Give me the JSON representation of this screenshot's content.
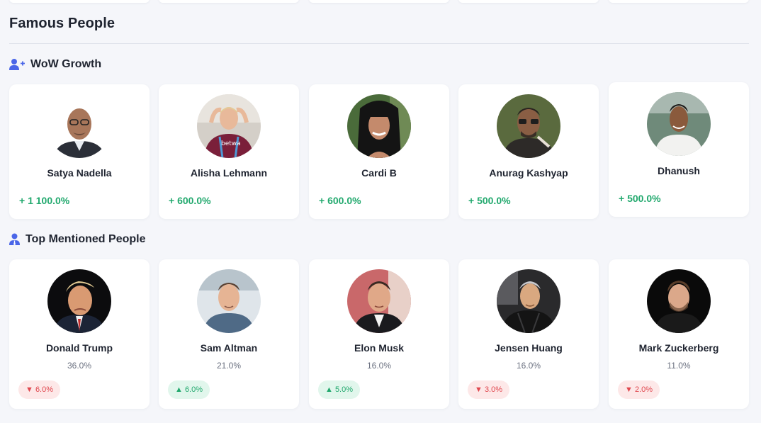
{
  "page": {
    "title": "Famous People"
  },
  "colors": {
    "accent": "#4a66e8",
    "growth": "#22a96e",
    "down_bg": "#fde8e8",
    "down_text": "#e0484f",
    "up_bg": "#e1f6ec",
    "up_text": "#22a96e"
  },
  "wow_growth": {
    "title": "WoW Growth",
    "icon": "user-plus-icon",
    "people": [
      {
        "name": "Satya Nadella",
        "growth": "+ 1 100.0%"
      },
      {
        "name": "Alisha Lehmann",
        "growth": "+ 600.0%"
      },
      {
        "name": "Cardi B",
        "growth": "+ 600.0%"
      },
      {
        "name": "Anurag Kashyap",
        "growth": "+ 500.0%"
      },
      {
        "name": "Dhanush",
        "growth": "+ 500.0%"
      }
    ]
  },
  "top_mentioned": {
    "title": "Top Mentioned People",
    "icon": "user-tie-icon",
    "people": [
      {
        "name": "Donald Trump",
        "share": "36.0%",
        "change": "▼ 6.0%",
        "direction": "down"
      },
      {
        "name": "Sam Altman",
        "share": "21.0%",
        "change": "▲ 6.0%",
        "direction": "up"
      },
      {
        "name": "Elon Musk",
        "share": "16.0%",
        "change": "▲ 5.0%",
        "direction": "up"
      },
      {
        "name": "Jensen Huang",
        "share": "16.0%",
        "change": "▼ 3.0%",
        "direction": "down"
      },
      {
        "name": "Mark Zuckerberg",
        "share": "11.0%",
        "change": "▼ 2.0%",
        "direction": "down"
      }
    ]
  }
}
